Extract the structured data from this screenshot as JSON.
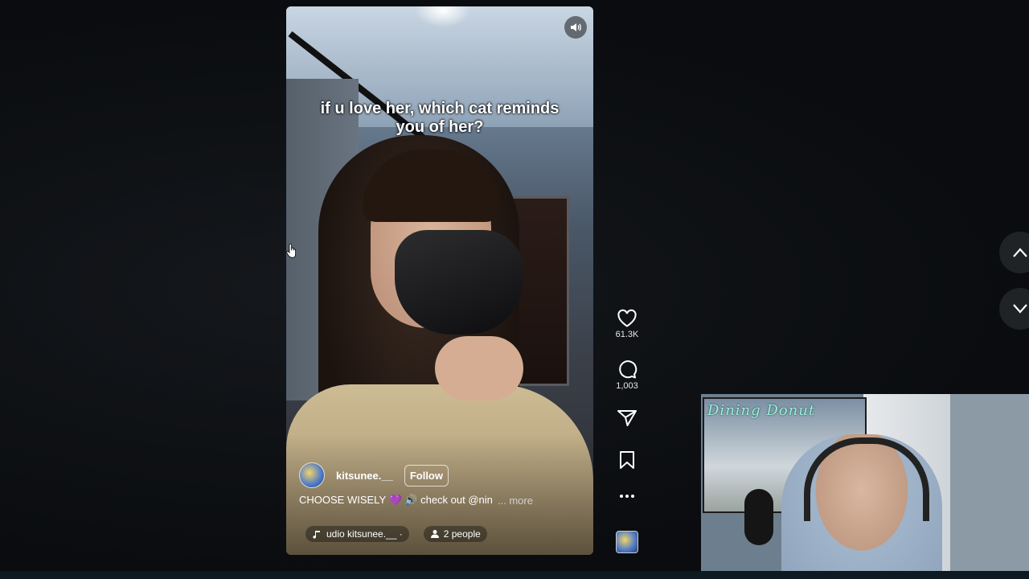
{
  "reel": {
    "caption": "if u love her, which cat reminds you of her?",
    "username": "kitsunee.__",
    "follow_label": "Follow",
    "description": "CHOOSE WISELY 💜 🔊 check out @nin",
    "more_label": "... more",
    "audio_label": "udio  kitsunee.__ ·",
    "people_label": "2 people",
    "mute_icon": "speaker-icon"
  },
  "actions": {
    "likes": "61.3K",
    "comments": "1,003",
    "icons": [
      "heart-icon",
      "comment-icon",
      "share-icon",
      "bookmark-icon",
      "more-icon"
    ]
  },
  "webcam": {
    "title": "Dining Donut"
  },
  "colors": {
    "background": "#0b0d10",
    "nav_button": "#1f2326",
    "webcam_title": "#9cf0dd"
  }
}
